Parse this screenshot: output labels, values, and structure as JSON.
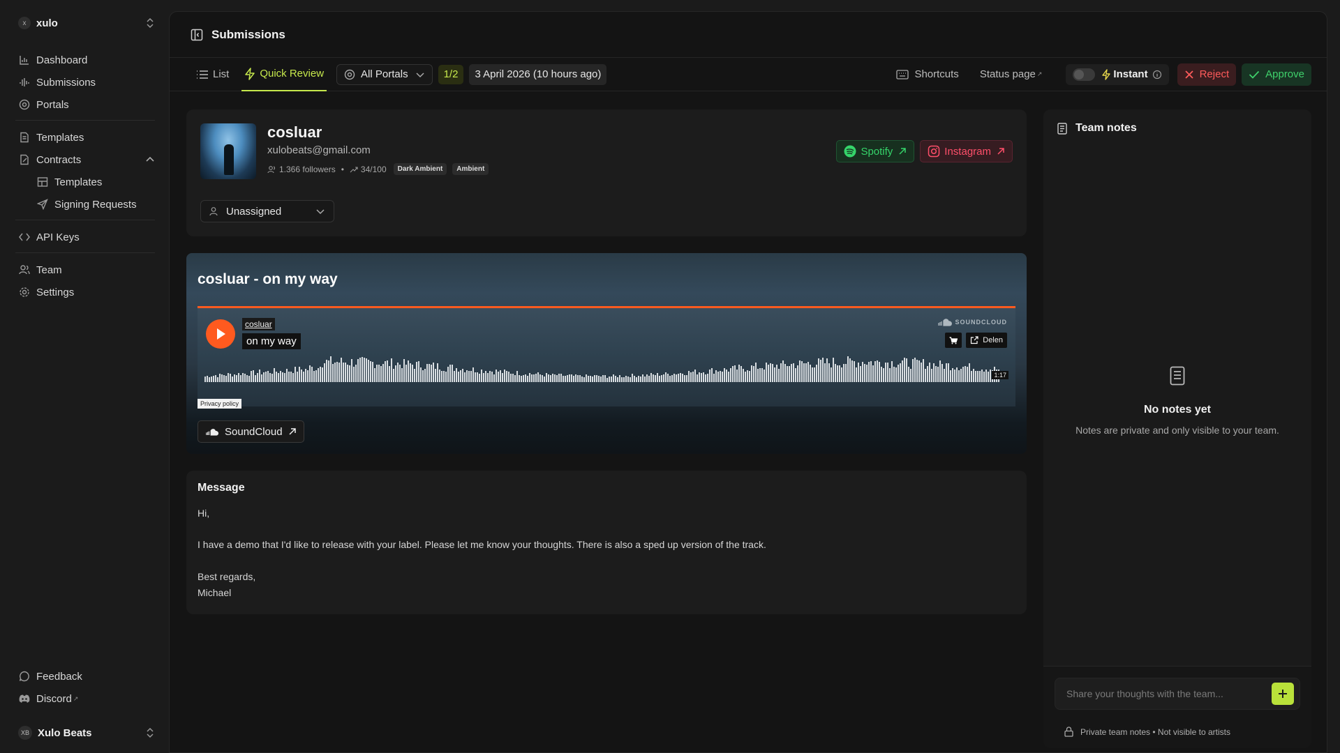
{
  "sidebar": {
    "workspace": {
      "avatar": "x",
      "name": "xulo"
    },
    "nav": [
      {
        "label": "Dashboard",
        "icon": "dashboard-icon"
      },
      {
        "label": "Submissions",
        "icon": "audio-waveform-icon"
      },
      {
        "label": "Portals",
        "icon": "portal-icon"
      }
    ],
    "nav2": [
      {
        "label": "Templates",
        "icon": "document-icon"
      },
      {
        "label": "Contracts",
        "icon": "contract-icon"
      }
    ],
    "contracts_sub": [
      {
        "label": "Templates",
        "icon": "layout-icon"
      },
      {
        "label": "Signing Requests",
        "icon": "send-icon"
      }
    ],
    "api_keys": "API Keys",
    "team": "Team",
    "settings": "Settings",
    "feedback": "Feedback",
    "discord": "Discord",
    "user": {
      "initials": "XB",
      "name": "Xulo Beats"
    }
  },
  "header": {
    "title": "Submissions"
  },
  "toolbar": {
    "list_label": "List",
    "quick_review_label": "Quick Review",
    "portal_select": "All Portals",
    "counter": "1/2",
    "date": "3 April 2026 (10 hours ago)",
    "shortcuts_label": "Shortcuts",
    "status_page_label": "Status page",
    "instant_label": "Instant",
    "reject_label": "Reject",
    "approve_label": "Approve"
  },
  "artist": {
    "name": "cosluar",
    "email": "xulobeats@gmail.com",
    "followers": "1.366 followers",
    "score": "34/100",
    "tags": [
      "Dark Ambient",
      "Ambient"
    ],
    "spotify_label": "Spotify",
    "instagram_label": "Instagram",
    "assignee": "Unassigned"
  },
  "track": {
    "title": "cosluar - on my way",
    "player_artist": "cosluar",
    "player_track": "on my way",
    "brand": "SOUNDCLOUD",
    "share_label": "Delen",
    "duration": "1:17",
    "privacy": "Privacy policy",
    "soundcloud_link": "SoundCloud"
  },
  "message": {
    "title": "Message",
    "greeting": "Hi,",
    "body": "I have a demo that I'd like to release with your label. Please let me know your thoughts. There is also a sped up version of the track.",
    "closing": "Best regards,",
    "signature": "Michael"
  },
  "notes": {
    "title": "Team notes",
    "empty_title": "No notes yet",
    "empty_text": "Notes are private and only visible to your team.",
    "input_placeholder": "Share your thoughts with the team...",
    "privacy_note": "Private team notes • Not visible to artists"
  },
  "colors": {
    "accent": "#c6e84c",
    "reject": "#ff5b5b",
    "approve": "#3fd16b",
    "soundcloud": "#ff5a1f",
    "spotify": "#35d46a",
    "instagram": "#ff4f6a"
  }
}
